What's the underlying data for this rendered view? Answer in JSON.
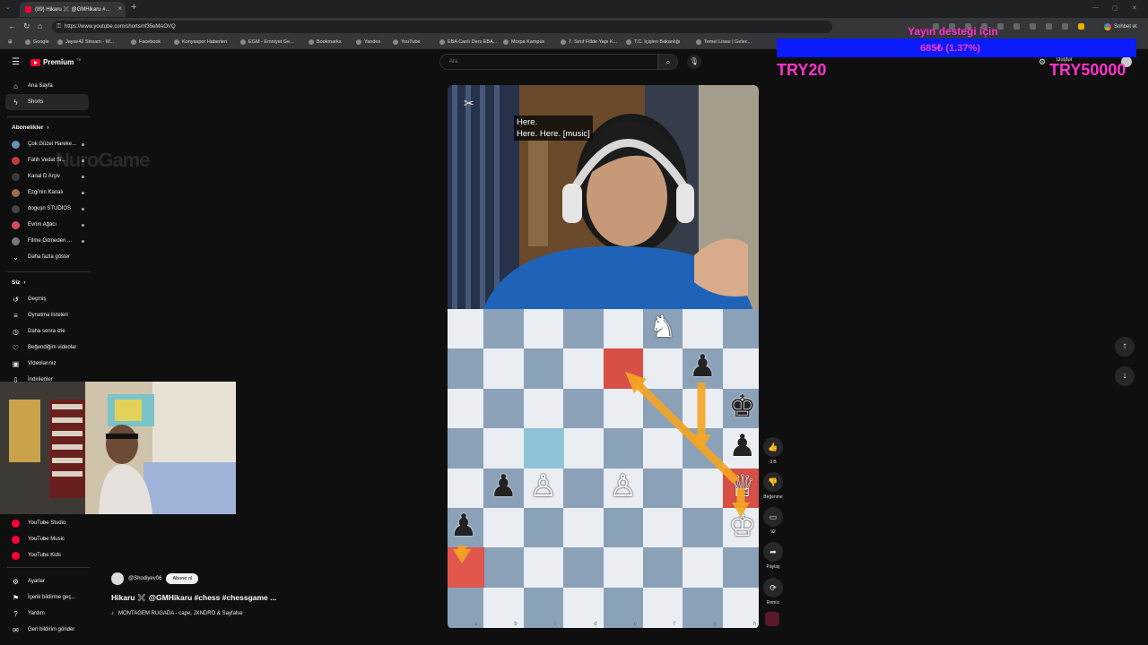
{
  "browser": {
    "tab_title": "(89) Hikaru ✖️ @GMHikaru #...",
    "url": "https://www.youtube.com/shorts/nf35eMAOVQ",
    "profile_chat": "Sohbet et",
    "bookmarks": [
      "Google",
      "Jayse42 Stream - W...",
      "Facebook",
      "Konyaspor Haberleri",
      "EGM - Emniyet Ge...",
      "Bookmarks",
      "Yandex",
      "YouTube",
      "EBA Canlı Ders EBA...",
      "Morpa Kampüs",
      "7. Sınıf Fiilde Yapı K...",
      "T.C. İçişleri Bakanlığı",
      "Temel Lirası | Gelec..."
    ]
  },
  "youtube": {
    "logo": "Premium",
    "logo_sup": "TR",
    "search_placeholder": "Ara",
    "header_right": "Duştur"
  },
  "sidebar": {
    "main": [
      {
        "label": "Ana Sayfa",
        "icon": "home-icon"
      },
      {
        "label": "Shorts",
        "icon": "shorts-icon"
      }
    ],
    "subs_heading": "Abonelikler",
    "subs": [
      {
        "label": "Çok Güzel Hareke...",
        "color": "#6b8fb0"
      },
      {
        "label": "Fatih Vedat Si...",
        "color": "#c23b3b"
      },
      {
        "label": "Kanal D Arşiv",
        "color": "#3b3b3b"
      },
      {
        "label": "Ezgi'nin Kanalı",
        "color": "#9b6b4b"
      },
      {
        "label": "doguşn STUDIOS",
        "color": "#444444"
      },
      {
        "label": "Evrim Ağacı",
        "color": "#d84a5a"
      },
      {
        "label": "Filme Gitmeden ...",
        "color": "#777777"
      }
    ],
    "show_more": "Daha fazla göster",
    "you_heading": "Siz",
    "you": [
      {
        "label": "Geçmiş",
        "icon": "history-icon"
      },
      {
        "label": "Oynatma listeleri",
        "icon": "playlists-icon"
      },
      {
        "label": "Daha sonra izle",
        "icon": "watch-later-icon"
      },
      {
        "label": "Beğendiğim videolar",
        "icon": "liked-icon"
      },
      {
        "label": "Videolarınız",
        "icon": "your-videos-icon"
      },
      {
        "label": "İndirilenler",
        "icon": "downloads-icon"
      }
    ],
    "more_from": [
      {
        "label": "YouTube Studio",
        "color": "#ff0033"
      },
      {
        "label": "YouTube Music",
        "color": "#ff0033"
      },
      {
        "label": "YouTube Kids",
        "color": "#ff0033"
      }
    ],
    "footer": [
      {
        "label": "Ayarlar",
        "icon": "settings-icon"
      },
      {
        "label": "İçerik bildirme geç...",
        "icon": "flag-icon"
      },
      {
        "label": "Yardım",
        "icon": "help-icon"
      },
      {
        "label": "Geri bildirim gönder",
        "icon": "feedback-icon"
      }
    ],
    "ghost_text": "NuroGame"
  },
  "short": {
    "caption_line1": "Here.",
    "caption_line2": "Here. Here. [music]",
    "channel": "@Shodiyev06",
    "subscribe": "Abone ol",
    "title": "Hikaru ✖️ @GMHikaru #chess #chessgame ...",
    "music": "MONTAGEM RUGADA - cape, JXNDRO & Sayfalse",
    "files": [
      "a",
      "b",
      "c",
      "d",
      "e",
      "f",
      "g",
      "h"
    ]
  },
  "actions": {
    "like_count": "3 B",
    "dislike": "Beğenme",
    "comments": "92",
    "share": "Paylaş",
    "remix": "Remix"
  },
  "overlay": {
    "title": "Yayın desteği için",
    "amount": "685₺ (1.37%)",
    "left_code": "TRY20",
    "right_code": "TRY50000"
  },
  "colors": {
    "light_square": "#eaedf2",
    "dark_square": "#8aa1b8",
    "highlight_red": "#e0463c",
    "highlight_blue": "#8ec6da",
    "arrow": "#f5a623",
    "overlay_blue": "#0a1bff",
    "overlay_pink": "#ff33cc"
  }
}
